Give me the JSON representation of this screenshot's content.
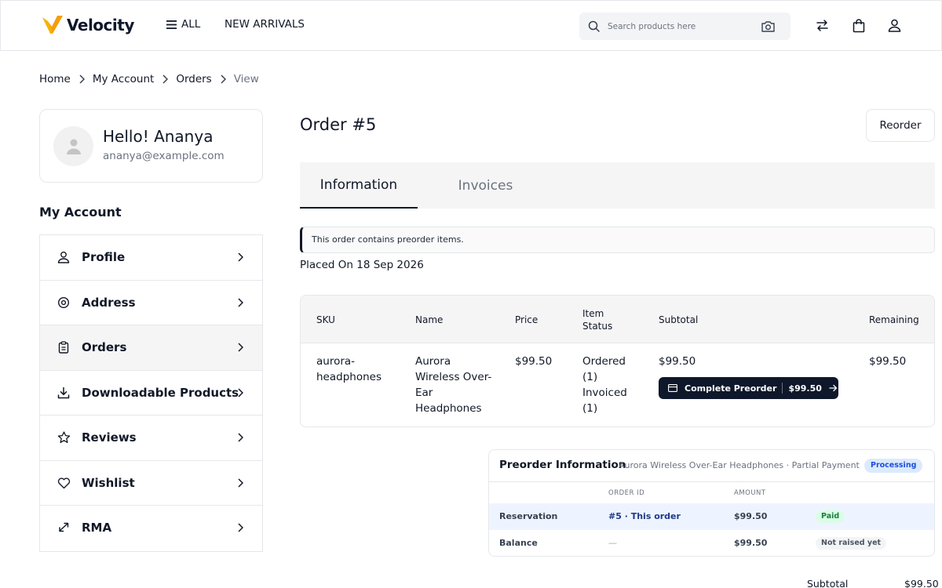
{
  "header": {
    "brand": "Velocity",
    "nav_all": "ALL",
    "nav_new": "NEW ARRIVALS",
    "search_placeholder": "Search products here",
    "accent": "#f5b301"
  },
  "breadcrumb": [
    "Home",
    "My Account",
    "Orders",
    "View"
  ],
  "profile": {
    "greeting": "Hello! Ananya",
    "email": "ananya@example.com"
  },
  "sidebar": {
    "heading": "My Account",
    "items": [
      {
        "label": "Profile",
        "icon": "user-icon"
      },
      {
        "label": "Address",
        "icon": "location-pin-icon"
      },
      {
        "label": "Orders",
        "icon": "clipboard-icon",
        "active": true
      },
      {
        "label": "Downloadable Products",
        "icon": "download-icon"
      },
      {
        "label": "Reviews",
        "icon": "star-icon"
      },
      {
        "label": "Wishlist",
        "icon": "heart-icon"
      },
      {
        "label": "RMA",
        "icon": "exchange-icon"
      }
    ]
  },
  "order": {
    "title": "Order #5",
    "reorder_label": "Reorder",
    "tabs": [
      "Information",
      "Invoices"
    ],
    "active_tab": "Information",
    "notice": "This order contains preorder items.",
    "placed_on": "Placed On 18 Sep 2026"
  },
  "items_table": {
    "headers": [
      "SKU",
      "Name",
      "Price",
      "Item Status",
      "Subtotal",
      "Remaining"
    ],
    "rows": [
      {
        "sku": "aurora-headphones",
        "name": "Aurora Wireless Over-Ear Headphones",
        "price": "$99.50",
        "status_ordered": "Ordered (1)",
        "status_invoiced": "Invoiced (1)",
        "subtotal": "$99.50",
        "remaining": "$99.50",
        "action_label": "Complete Preorder",
        "action_amount": "$99.50"
      }
    ]
  },
  "preorder": {
    "title": "Preorder Information",
    "subtitle": "Aurora Wireless Over-Ear Headphones · Partial Payment",
    "status": "Processing",
    "columns": [
      "ORDER ID",
      "AMOUNT"
    ],
    "rows": [
      {
        "label": "Reservation",
        "order_id": "#5 · This order",
        "amount": "$99.50",
        "badge": "Paid"
      },
      {
        "label": "Balance",
        "order_id": "—",
        "amount": "$99.50",
        "badge": "Not raised yet"
      }
    ]
  },
  "totals": {
    "subtotal_label": "Subtotal",
    "subtotal_value": "$99.50"
  }
}
